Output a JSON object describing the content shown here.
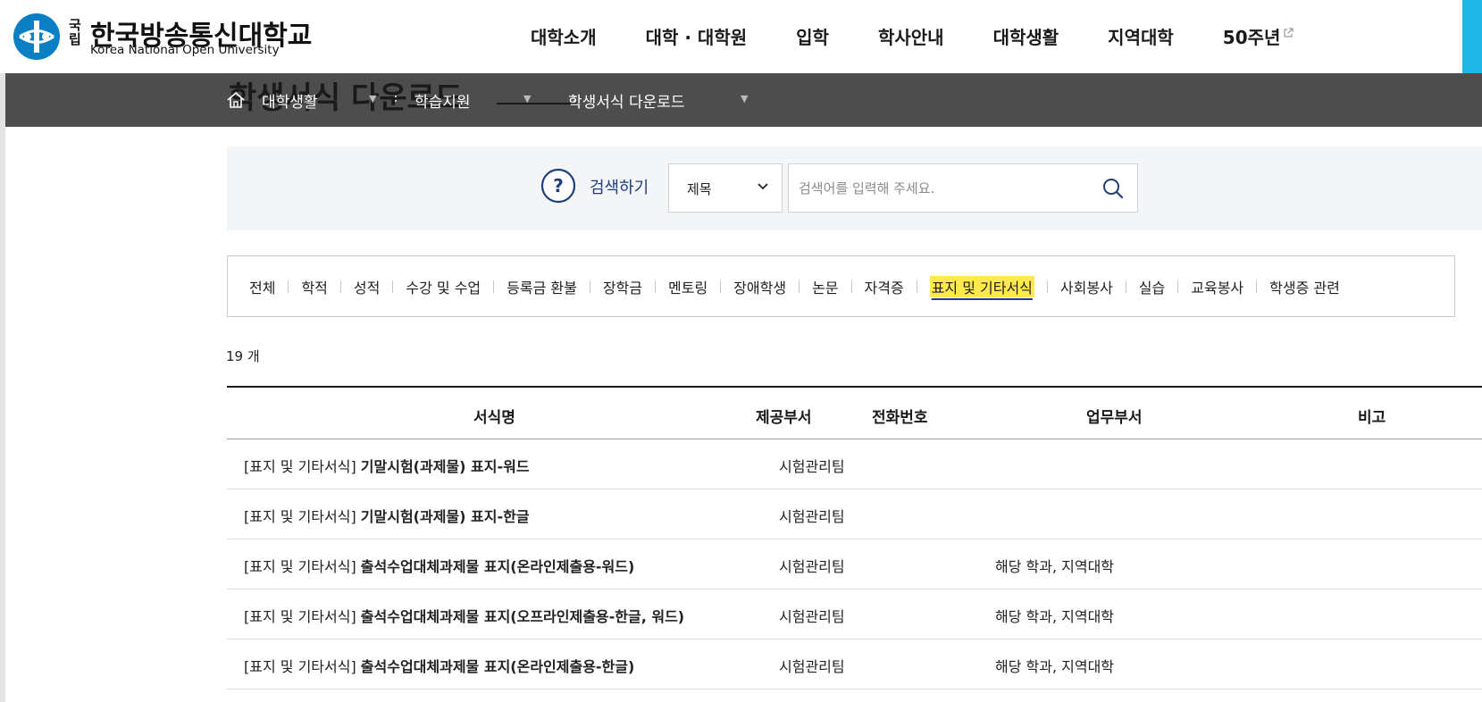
{
  "header": {
    "logo": {
      "small": "국립",
      "ko": "한국방송통신대학교",
      "en": "Korea National Open University"
    },
    "nav": [
      {
        "label": "대학소개"
      },
      {
        "label": "대학 · 대학원"
      },
      {
        "label": "입학"
      },
      {
        "label": "학사안내"
      },
      {
        "label": "대학생활"
      },
      {
        "label": "지역대학"
      },
      {
        "label": "50주년",
        "external": true
      }
    ]
  },
  "page_title": "학생서식 다운로드",
  "breadcrumb": {
    "items": [
      "대학생활",
      "학습지원",
      "학생서식 다운로드"
    ]
  },
  "search": {
    "help_label": "검색하기",
    "select_value": "제목",
    "placeholder": "검색어를 입력해 주세요."
  },
  "tabs": {
    "items": [
      "전체",
      "학적",
      "성적",
      "수강 및 수업",
      "등록금 환불",
      "장학금",
      "멘토링",
      "장애학생",
      "논문",
      "자격증",
      "표지 및 기타서식",
      "사회봉사",
      "실습",
      "교육봉사",
      "학생증 관련"
    ],
    "active": "표지 및 기타서식"
  },
  "count": {
    "number": "19",
    "unit": "개"
  },
  "table": {
    "columns": [
      "서식명",
      "제공부서",
      "전화번호",
      "업무부서",
      "비고"
    ],
    "rows": [
      {
        "prefix": "[표지 및 기타서식]",
        "name": "기말시험(과제물) 표지-워드",
        "dept": "시험관리팀",
        "phone": "",
        "work": "",
        "note": ""
      },
      {
        "prefix": "[표지 및 기타서식]",
        "name": "기말시험(과제물) 표지-한글",
        "dept": "시험관리팀",
        "phone": "",
        "work": "",
        "note": ""
      },
      {
        "prefix": "[표지 및 기타서식]",
        "name": "출석수업대체과제물 표지(온라인제출용-워드)",
        "dept": "시험관리팀",
        "phone": "",
        "work": "해당 학과, 지역대학",
        "note": ""
      },
      {
        "prefix": "[표지 및 기타서식]",
        "name": "출석수업대체과제물 표지(오프라인제출용-한글, 워드)",
        "dept": "시험관리팀",
        "phone": "",
        "work": "해당 학과, 지역대학",
        "note": ""
      },
      {
        "prefix": "[표지 및 기타서식]",
        "name": "출석수업대체과제물 표지(온라인제출용-한글)",
        "dept": "시험관리팀",
        "phone": "",
        "work": "해당 학과, 지역대학",
        "note": ""
      }
    ]
  },
  "colors": {
    "brand_blue": "#1f3f7a",
    "logo_blue": "#0a7fc4",
    "crumb_bg": "#4d4d4d",
    "active_tab_bg": "#ffe94d",
    "accent_cyan": "#1fb6e8"
  },
  "icons": {
    "logo": "knou-emblem-icon",
    "home": "home-icon",
    "help": "question-circle-icon",
    "select": "chevron-down-icon",
    "search": "search-icon",
    "external": "external-link-icon"
  }
}
